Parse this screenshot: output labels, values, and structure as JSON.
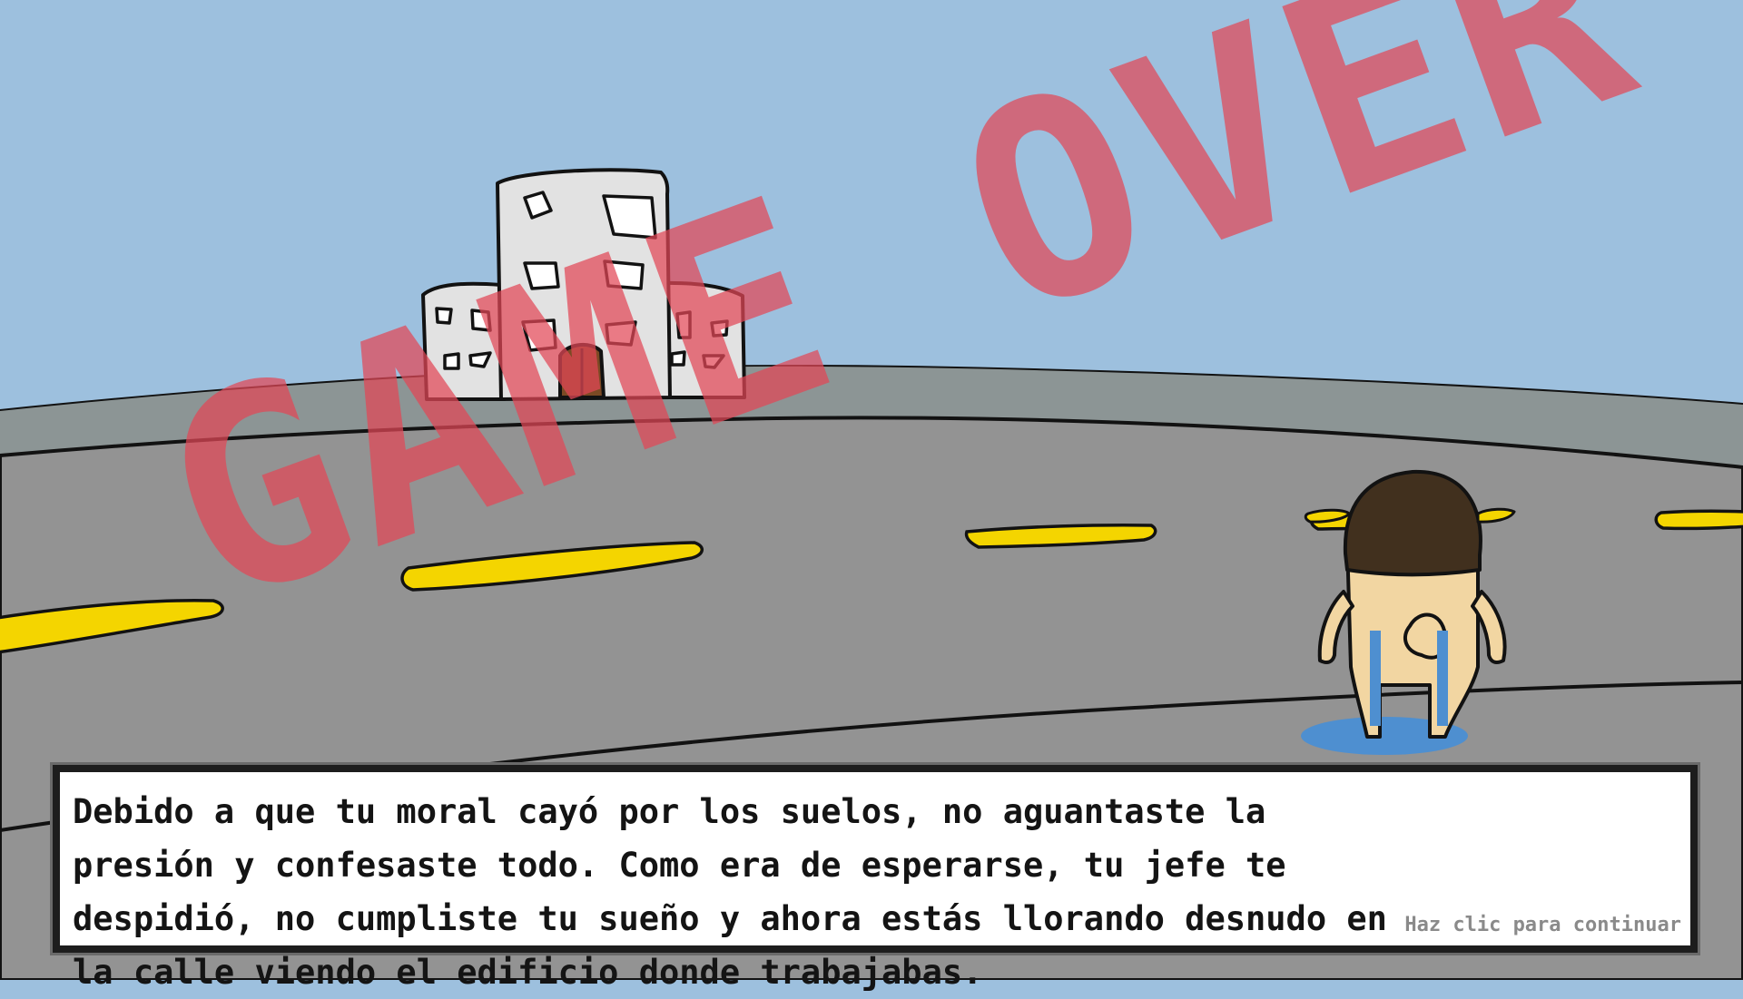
{
  "overlay": {
    "title": "GAME OVER"
  },
  "dialog": {
    "text": "Debido a que tu moral cayó por los suelos, no aguantaste la presión y confesaste todo. Como era de esperarse, tu jefe te despidió, no cumpliste tu sueño y ahora estás llorando desnudo en la calle viendo el edificio donde trabajabas.",
    "continue_hint": "Haz clic para continuar"
  },
  "colors": {
    "sky": "#9dc0de",
    "road": "#939393",
    "road_far": "#8c9595",
    "lane_marking": "#f4d500",
    "building": "#e2e2e2",
    "game_over_text": "#e24656",
    "hair": "#41301e",
    "skin": "#f2d6a2",
    "tears": "#4e8fd0"
  },
  "scene": {
    "building": "office-building",
    "character": "crying-naked-character"
  }
}
